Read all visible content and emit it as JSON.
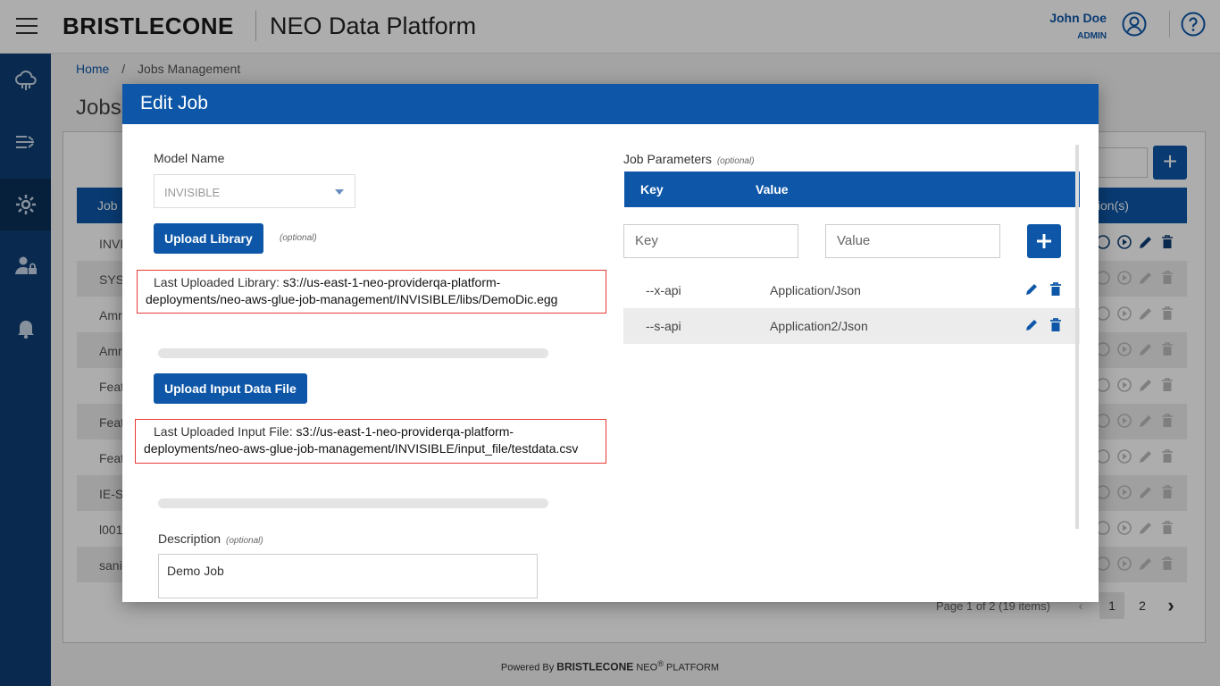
{
  "header": {
    "brand": "BRISTLECONE",
    "platform": "NEO Data Platform",
    "user_name": "John Doe",
    "user_role": "ADMIN"
  },
  "sidebar": {
    "icons": [
      "cloud-network-icon",
      "pipeline-icon",
      "settings-gear-icon",
      "user-admin-icon",
      "notification-bell-icon"
    ]
  },
  "breadcrumb": {
    "home": "Home",
    "sep": "/",
    "current": "Jobs Management"
  },
  "page": {
    "title": "Jobs",
    "col_job": "Job",
    "col_actions": "ction(s)",
    "rows": [
      "INVI",
      "SYS-",
      "Amr",
      "Amr",
      "Feat",
      "Feat",
      "Feat",
      "IE-Si",
      "l001",
      "sani"
    ]
  },
  "pagination": {
    "info": "Page 1 of 2 (19 items)",
    "page1": "1",
    "page2": "2"
  },
  "footer": {
    "powered": "Powered By",
    "brand": "BRISTLECONE",
    "neo": "NEO",
    "reg": "®",
    "platform": "PLATFORM"
  },
  "modal": {
    "title": "Edit Job",
    "model_name_label": "Model Name",
    "model_name_value": "INVISIBLE",
    "upload_library_label": "Upload Library",
    "optional": "(optional)",
    "last_library_label": "Last Uploaded Library:",
    "last_library_path": "s3://us-east-1-neo-providerqa-platform-deployments/neo-aws-glue-job-management/INVISIBLE/libs/DemoDic.egg",
    "upload_input_label": "Upload Input Data File",
    "last_input_label": "Last Uploaded Input File:",
    "last_input_path": "s3://us-east-1-neo-providerqa-platform-deployments/neo-aws-glue-job-management/INVISIBLE/input_file/testdata.csv",
    "description_label": "Description",
    "description_value": "Demo Job",
    "job_params_label": "Job Parameters",
    "params_key_header": "Key",
    "params_value_header": "Value",
    "key_placeholder": "Key",
    "value_placeholder": "Value",
    "params": [
      {
        "key": "--x-api",
        "value": "Application/Json"
      },
      {
        "key": "--s-api",
        "value": "Application2/Json"
      }
    ]
  },
  "colors": {
    "primary": "#0e57a8",
    "sidebar": "#0e3f74",
    "highlight_border": "#e53935"
  }
}
